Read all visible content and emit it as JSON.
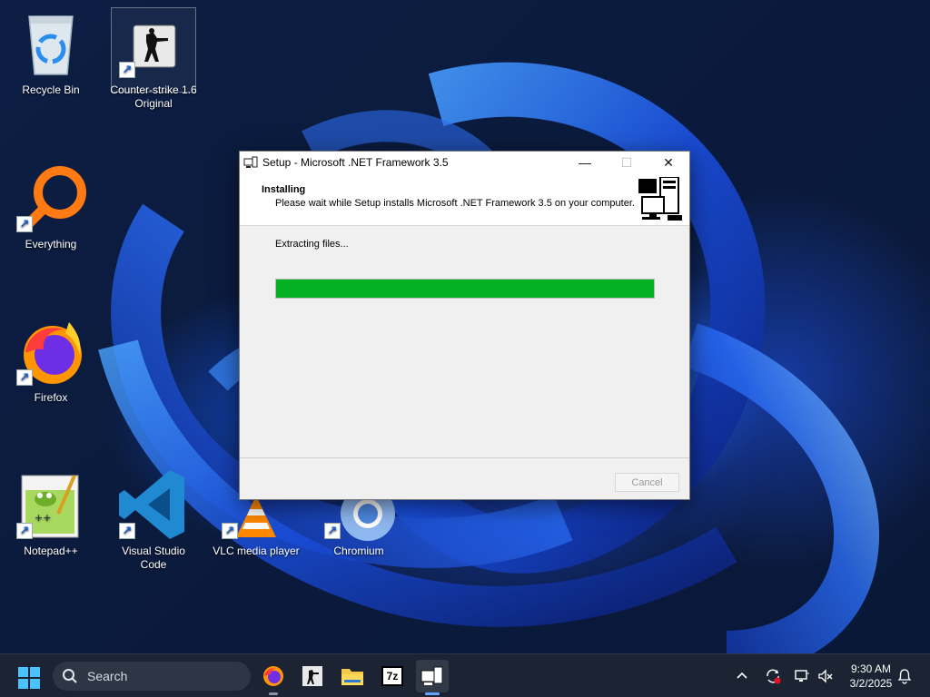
{
  "desktop": {
    "icons": [
      {
        "label": "Recycle Bin",
        "icon": "recycle-bin-icon"
      },
      {
        "label": "Counter-strike 1.6 Original",
        "icon": "counter-strike-icon"
      },
      {
        "label": "Everything",
        "icon": "everything-search-icon"
      },
      {
        "label": "Firefox",
        "icon": "firefox-icon"
      },
      {
        "label": "Notepad++",
        "icon": "notepad-plus-plus-icon"
      },
      {
        "label": "Visual Studio Code",
        "icon": "vscode-icon"
      },
      {
        "label": "VLC media player",
        "icon": "vlc-icon"
      },
      {
        "label": "Chromium",
        "icon": "chromium-icon"
      }
    ]
  },
  "setup_window": {
    "title": "Setup - Microsoft .NET Framework 3.5",
    "header_title": "Installing",
    "header_subtitle": "Please wait while Setup installs Microsoft .NET Framework 3.5 on your computer.",
    "status": "Extracting files...",
    "progress_fraction": 1.0,
    "progress_color": "#06b025",
    "cancel_label": "Cancel",
    "minimize_glyph": "—",
    "maximize_glyph": "☐",
    "close_glyph": "✕"
  },
  "taskbar": {
    "search_placeholder": "Search",
    "apps": [
      "firefox-icon",
      "counter-strike-icon",
      "file-explorer-icon",
      "7zip-icon",
      "setup-icon"
    ],
    "seven_zip_text": "7z",
    "clock_time": "9:30 AM",
    "clock_date": "3/2/2025",
    "tray_chevron": "^"
  }
}
